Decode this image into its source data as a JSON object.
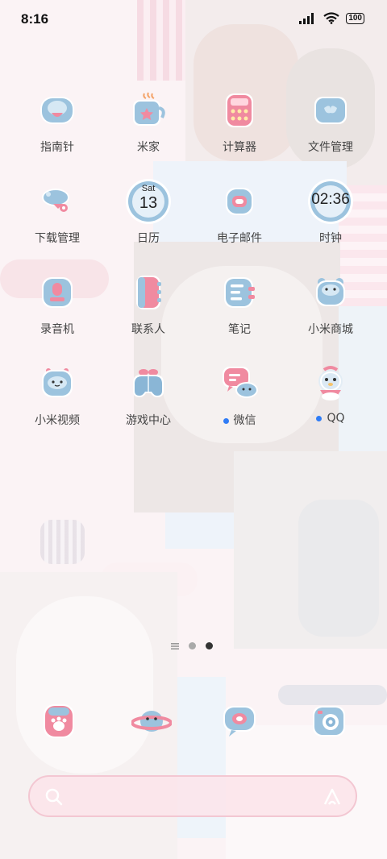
{
  "status_bar": {
    "time": "8:16",
    "battery": "100",
    "icons": [
      "cellular-signal-icon",
      "wifi-icon",
      "battery-icon"
    ]
  },
  "apps": [
    {
      "label": "指南针",
      "icon": "compass-icon",
      "notify": false
    },
    {
      "label": "米家",
      "icon": "mijia-icon",
      "notify": false
    },
    {
      "label": "计算器",
      "icon": "calculator-icon",
      "notify": false
    },
    {
      "label": "文件管理",
      "icon": "file-manager-icon",
      "notify": false
    },
    {
      "label": "下载管理",
      "icon": "download-manager-icon",
      "notify": false
    },
    {
      "label": "日历",
      "icon": "calendar-icon",
      "notify": false,
      "weekday": "Sat",
      "day": "13"
    },
    {
      "label": "电子邮件",
      "icon": "email-icon",
      "notify": false
    },
    {
      "label": "时钟",
      "icon": "clock-icon",
      "notify": false,
      "clock_time": "02:36"
    },
    {
      "label": "录音机",
      "icon": "recorder-icon",
      "notify": false
    },
    {
      "label": "联系人",
      "icon": "contacts-icon",
      "notify": false
    },
    {
      "label": "笔记",
      "icon": "notes-icon",
      "notify": false
    },
    {
      "label": "小米商城",
      "icon": "mi-store-icon",
      "notify": false
    },
    {
      "label": "小米视频",
      "icon": "mi-video-icon",
      "notify": false
    },
    {
      "label": "游戏中心",
      "icon": "game-center-icon",
      "notify": false
    },
    {
      "label": "微信",
      "icon": "wechat-icon",
      "notify": true
    },
    {
      "label": "QQ",
      "icon": "qq-icon",
      "notify": true
    }
  ],
  "pager": {
    "pages": 2,
    "current": 2,
    "icons": [
      "home-menu-icon"
    ]
  },
  "dock": [
    {
      "icon": "phone-dock-icon"
    },
    {
      "icon": "browser-dock-icon"
    },
    {
      "icon": "messages-dock-icon"
    },
    {
      "icon": "camera-dock-icon"
    }
  ],
  "search_bar": {
    "icons": [
      "search-icon",
      "assistant-icon"
    ]
  },
  "colors": {
    "icon_blue": "#8ab6d6",
    "icon_pink": "#f08aa0",
    "accent_dot": "#2f7cf6",
    "label": "#444444"
  }
}
